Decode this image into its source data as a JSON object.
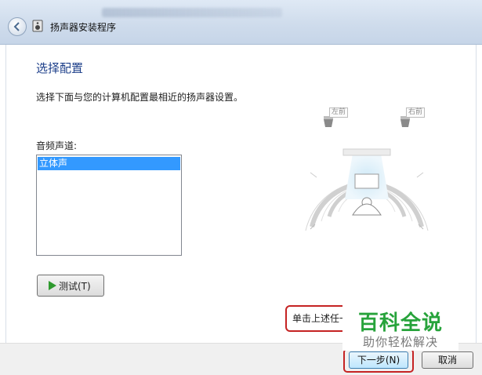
{
  "window": {
    "title": "扬声器安装程序"
  },
  "page": {
    "heading": "选择配置",
    "instruction": "选择下面与您的计算机配置最相近的扬声器设置。",
    "channels_label": "音频声道:",
    "channels": [
      {
        "label": "立体声",
        "selected": true
      }
    ],
    "test_button": "测试(T)"
  },
  "diagram": {
    "left_speaker": "左前",
    "right_speaker": "右前"
  },
  "hint": {
    "text": "单击上述任一"
  },
  "footer": {
    "next_button": "下一步(N)",
    "cancel_button": "取消"
  },
  "watermark": {
    "title": "百科全说",
    "subtitle": "助你轻松解决"
  },
  "colors": {
    "accent": "#1d3f8a",
    "selection": "#3399ff",
    "highlight": "#c52323",
    "brand": "#27a33b"
  }
}
